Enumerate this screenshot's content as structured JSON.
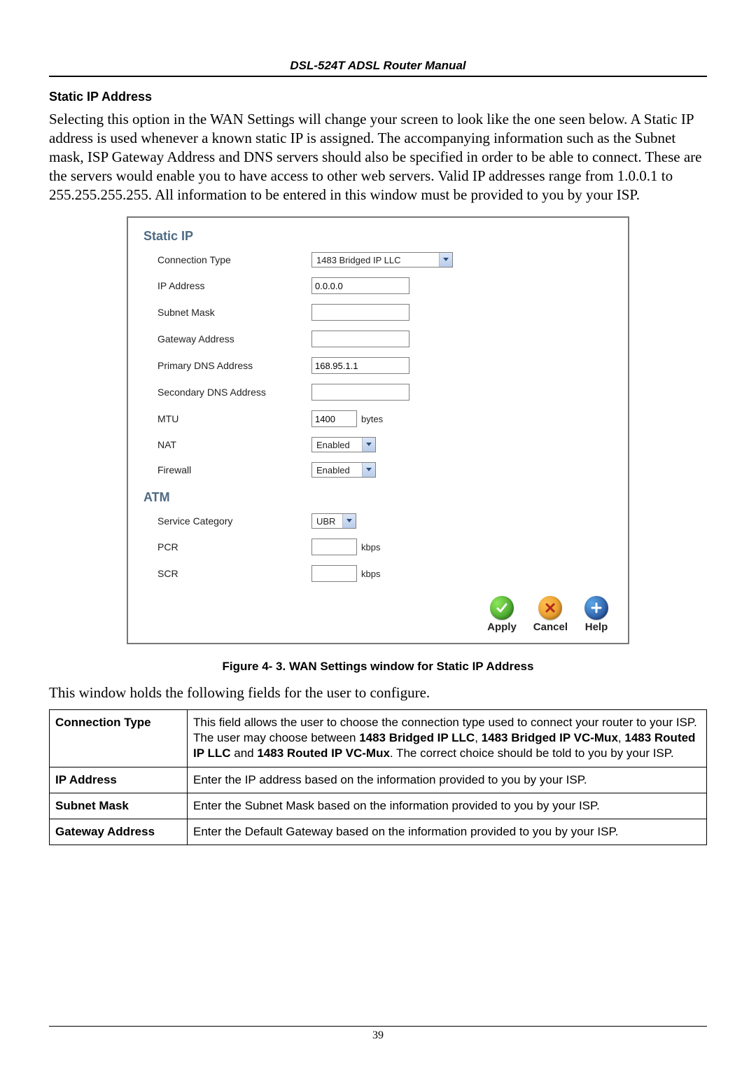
{
  "header": {
    "doc_title": "DSL-524T ADSL Router Manual"
  },
  "intro": {
    "heading": "Static IP Address",
    "paragraph": "Selecting this option in the WAN Settings will change your screen to look like the one seen below. A Static IP address is used whenever a known static IP is assigned. The accompanying information such as the Subnet mask, ISP Gateway Address and DNS servers should also be specified in order to be able to connect. These are the servers would enable you to have access to other web servers. Valid IP addresses range from 1.0.0.1 to 255.255.255.255. All information to be entered in this window must be provided to you by your ISP."
  },
  "panel": {
    "static_ip_title": "Static IP",
    "atm_title": "ATM",
    "labels": {
      "connection_type": "Connection Type",
      "ip_address": "IP Address",
      "subnet_mask": "Subnet Mask",
      "gateway_address": "Gateway Address",
      "primary_dns": "Primary DNS Address",
      "secondary_dns": "Secondary DNS Address",
      "mtu": "MTU",
      "nat": "NAT",
      "firewall": "Firewall",
      "service_category": "Service Category",
      "pcr": "PCR",
      "scr": "SCR"
    },
    "values": {
      "connection_type": "1483 Bridged IP LLC",
      "ip_address": "0.0.0.0",
      "subnet_mask": "",
      "gateway_address": "",
      "primary_dns": "168.95.1.1",
      "secondary_dns": "",
      "mtu": "1400",
      "nat": "Enabled",
      "firewall": "Enabled",
      "service_category": "UBR",
      "pcr": "",
      "scr": ""
    },
    "units": {
      "bytes": "bytes",
      "kbps": "kbps"
    },
    "actions": {
      "apply": "Apply",
      "cancel": "Cancel",
      "help": "Help"
    }
  },
  "figure_caption": "Figure 4- 3. WAN Settings window for Static IP Address",
  "followup_text": "This window holds the following fields for the user to configure.",
  "table": {
    "rows": [
      {
        "label": "Connection Type",
        "desc_pre": "This field allows the user to choose the connection type used to connect your router to your ISP. The user may choose between ",
        "bold1": "1483 Bridged IP LLC",
        "sep1": ", ",
        "bold2": "1483 Bridged IP VC-Mux",
        "sep2": ", ",
        "bold3": "1483 Routed IP LLC",
        "sep3": " and ",
        "bold4": "1483 Routed IP VC-Mux",
        "desc_post": ". The correct choice should be told to you by your ISP."
      },
      {
        "label": "IP Address",
        "desc": "Enter the IP address based on the information provided to you by your ISP."
      },
      {
        "label": "Subnet Mask",
        "desc": "Enter the Subnet Mask based on the information provided to you by your ISP."
      },
      {
        "label": "Gateway Address",
        "desc": "Enter the Default Gateway based on the information provided to you by your ISP."
      }
    ]
  },
  "page_number": "39"
}
